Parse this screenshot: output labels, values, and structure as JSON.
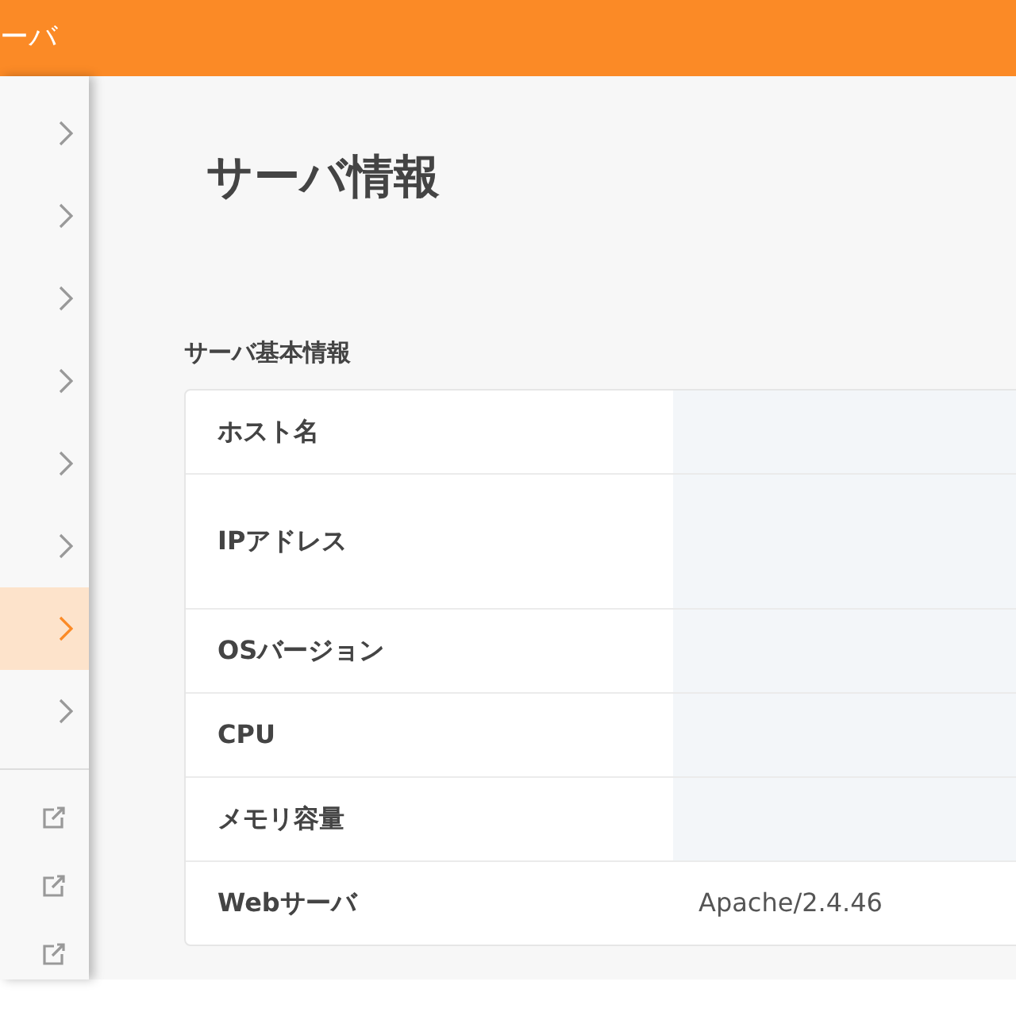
{
  "header": {
    "title": "ーバ"
  },
  "sidebar": {
    "items": [
      {
        "kind": "nav",
        "selected": false
      },
      {
        "kind": "nav",
        "selected": false
      },
      {
        "kind": "nav",
        "selected": false
      },
      {
        "kind": "nav",
        "selected": false
      },
      {
        "kind": "nav",
        "selected": false
      },
      {
        "kind": "nav",
        "selected": false
      },
      {
        "kind": "nav",
        "selected": true
      },
      {
        "kind": "nav",
        "selected": false
      },
      {
        "kind": "external",
        "selected": false
      },
      {
        "kind": "external",
        "selected": false
      },
      {
        "kind": "external",
        "selected": false
      }
    ]
  },
  "page": {
    "title": "サーバ情報",
    "section": "サーバ基本情報"
  },
  "table": {
    "rows": [
      {
        "label": "ホスト名",
        "masked": true,
        "tall": false
      },
      {
        "label": "IPアドレス",
        "masked": true,
        "tall": true
      },
      {
        "label": "OSバージョン",
        "masked": true,
        "tall": false
      },
      {
        "label": "CPU",
        "masked": true,
        "tall": false
      },
      {
        "label": "メモリ容量",
        "masked": true,
        "tall": false
      },
      {
        "label": "Webサーバ",
        "masked": false,
        "tall": false,
        "value": "Apache/2.4.46"
      }
    ]
  }
}
